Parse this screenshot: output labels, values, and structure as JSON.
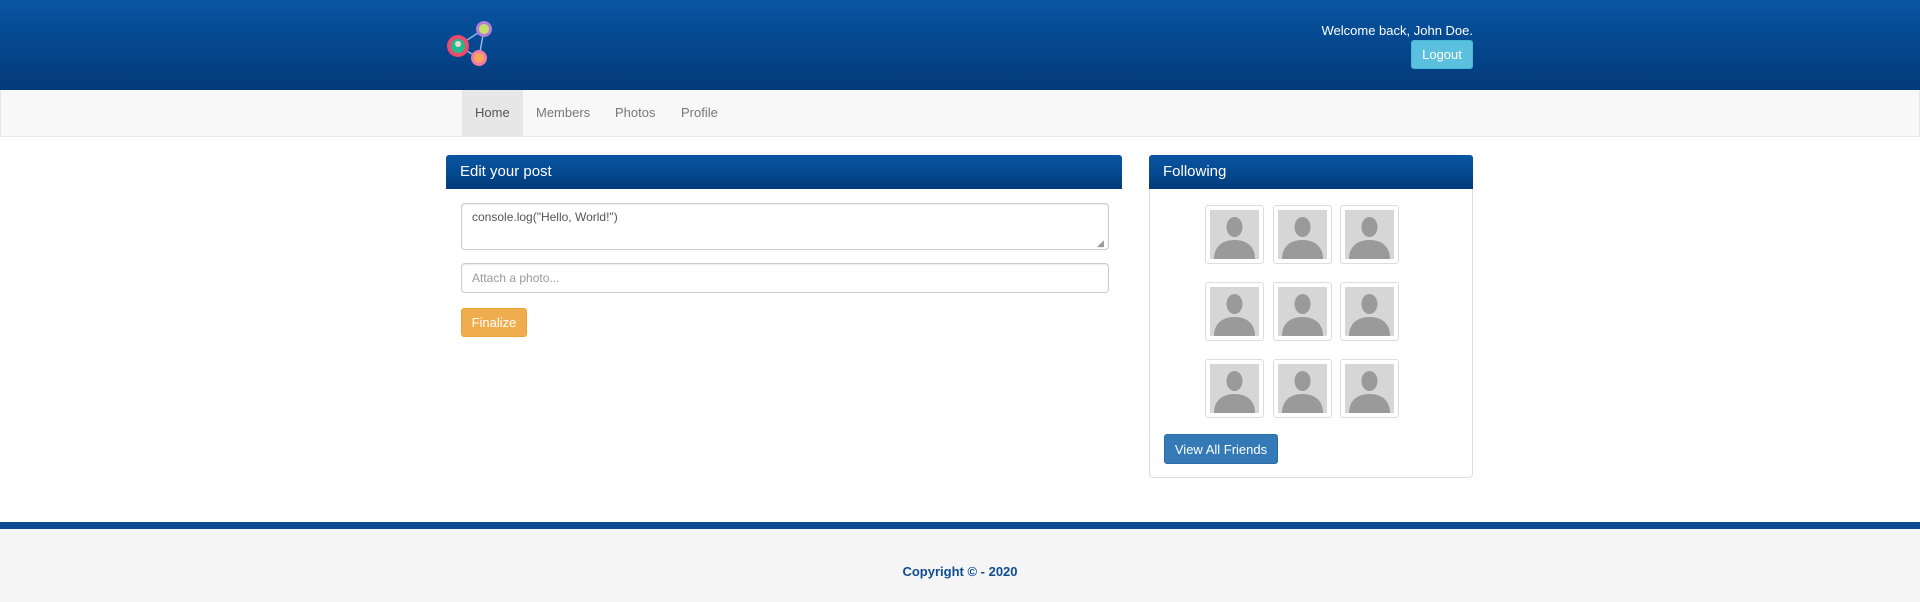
{
  "header": {
    "logo_icon": "network-people-icon",
    "welcome_text": "Welcome back, John Doe.",
    "logout_label": "Logout"
  },
  "nav": {
    "items": [
      {
        "label": "Home",
        "active": true
      },
      {
        "label": "Members",
        "active": false
      },
      {
        "label": "Photos",
        "active": false
      },
      {
        "label": "Profile",
        "active": false
      }
    ]
  },
  "post_panel": {
    "title": "Edit your post",
    "textarea_value": "console.log(\"Hello, World!\")",
    "photo_placeholder": "Attach a photo...",
    "finalize_label": "Finalize"
  },
  "following_panel": {
    "title": "Following",
    "friend_icon": "default-avatar-icon",
    "friend_count": 9,
    "view_all_label": "View All Friends"
  },
  "footer": {
    "copyright": "Copyright © - 2020"
  },
  "colors": {
    "header_blue": "#054a92",
    "logout_btn": "#5bc0de",
    "finalize_btn": "#f0ad4e",
    "view_all_btn": "#337ab7"
  }
}
